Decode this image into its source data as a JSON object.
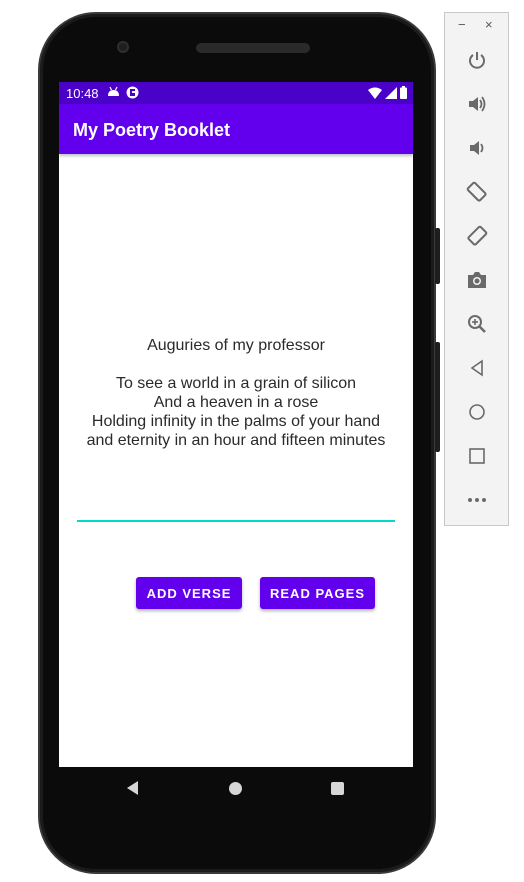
{
  "status_bar": {
    "time": "10:48",
    "left_icons": [
      "android-debug-icon",
      "app-notification-icon"
    ],
    "right_icons": [
      "wifi-icon",
      "signal-icon",
      "battery-icon"
    ]
  },
  "app_bar": {
    "title": "My Poetry Booklet"
  },
  "poem": {
    "title": "Auguries of my professor",
    "lines": [
      "To see a world in a grain of silicon",
      "And a heaven in a rose",
      "Holding infinity in the palms of your hand",
      "and eternity in an hour and fifteen minutes"
    ]
  },
  "verse_input": {
    "value": "",
    "placeholder": ""
  },
  "buttons": {
    "add_verse": "ADD VERSE",
    "read_pages": "READ PAGES"
  },
  "emulator_panel": {
    "minimize": "−",
    "close": "×",
    "tools": [
      "power-icon",
      "volume-up-icon",
      "volume-down-icon",
      "rotate-left-icon",
      "rotate-right-icon",
      "camera-icon",
      "zoom-icon",
      "back-icon",
      "home-icon",
      "overview-icon",
      "more-icon"
    ]
  },
  "colors": {
    "primary": "#6200ee",
    "primary_dark": "#4a02c9",
    "accent": "#03dac5"
  }
}
